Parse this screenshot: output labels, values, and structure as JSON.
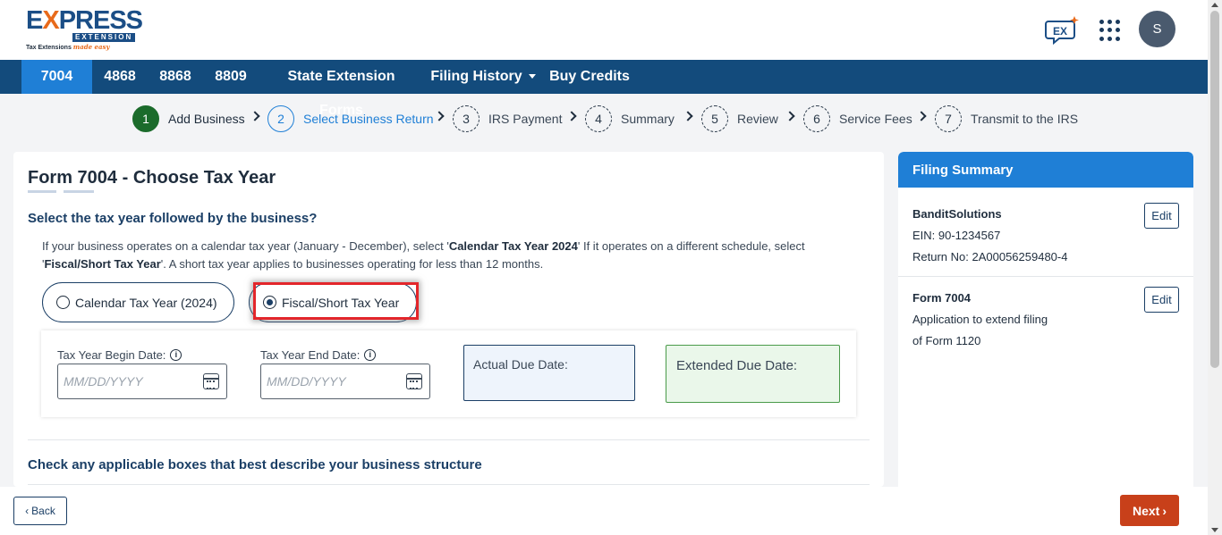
{
  "header": {
    "logo_main_pre": "E",
    "logo_main_x": "X",
    "logo_main_post": "PRESS",
    "logo_extension": "EXTENSION",
    "logo_tag": "Tax Extensions",
    "logo_tag_script": "made easy",
    "avatar_initial": "S",
    "icons": [
      "chat-support-icon",
      "apps-grid-icon"
    ]
  },
  "nav": {
    "items": [
      {
        "label": "7004",
        "active": true
      },
      {
        "label": "4868"
      },
      {
        "label": "8868"
      },
      {
        "label": "8809"
      },
      {
        "label": "State Extension Forms"
      },
      {
        "label": "Filing History"
      },
      {
        "label": "Buy Credits"
      }
    ]
  },
  "stepper": {
    "steps": [
      {
        "num": "1",
        "label": "Add Business",
        "state": "done"
      },
      {
        "num": "2",
        "label": "Select Business Return",
        "state": "current"
      },
      {
        "num": "3",
        "label": "IRS Payment"
      },
      {
        "num": "4",
        "label": "Summary"
      },
      {
        "num": "5",
        "label": "Review"
      },
      {
        "num": "6",
        "label": "Service Fees"
      },
      {
        "num": "7",
        "label": "Transmit to the IRS"
      }
    ]
  },
  "main": {
    "title": "Form 7004 - Choose Tax Year",
    "question": "Select the tax year followed by the business?",
    "desc_1": "If your business operates on a calendar tax year (January - December), select '",
    "desc_b1": "Calendar Tax Year 2024",
    "desc_2": "' If it operates on a different schedule, select '",
    "desc_b2": "Fiscal/Short Tax Year",
    "desc_3": "'. A short tax year applies to businesses operating for less than 12 months.",
    "options": [
      {
        "label": "Calendar Tax Year (2024)",
        "selected": false
      },
      {
        "label": "Fiscal/Short Tax Year",
        "selected": true
      }
    ],
    "begin_label": "Tax Year Begin Date:",
    "begin_placeholder": "MM/DD/YYYY",
    "end_label": "Tax Year End Date:",
    "end_placeholder": "MM/DD/YYYY",
    "actual_due": "Actual Due Date:",
    "extended_due": "Extended Due Date:",
    "question2": "Check any applicable boxes that best describe your business structure"
  },
  "summary": {
    "title": "Filing Summary",
    "business_name": "BanditSolutions",
    "ein": "EIN: 90-1234567",
    "return_no": "Return No: 2A00056259480-4",
    "form": "Form 7004",
    "form_desc_1": "Application to extend filing",
    "form_desc_2": "of Form 1120",
    "edit_label": "Edit"
  },
  "footer": {
    "back": "Back",
    "next": "Next"
  },
  "colors": {
    "nav_bg": "#134b7c",
    "accent": "#1f7fd6",
    "next_btn": "#c8401a",
    "highlight": "#e3262b"
  }
}
